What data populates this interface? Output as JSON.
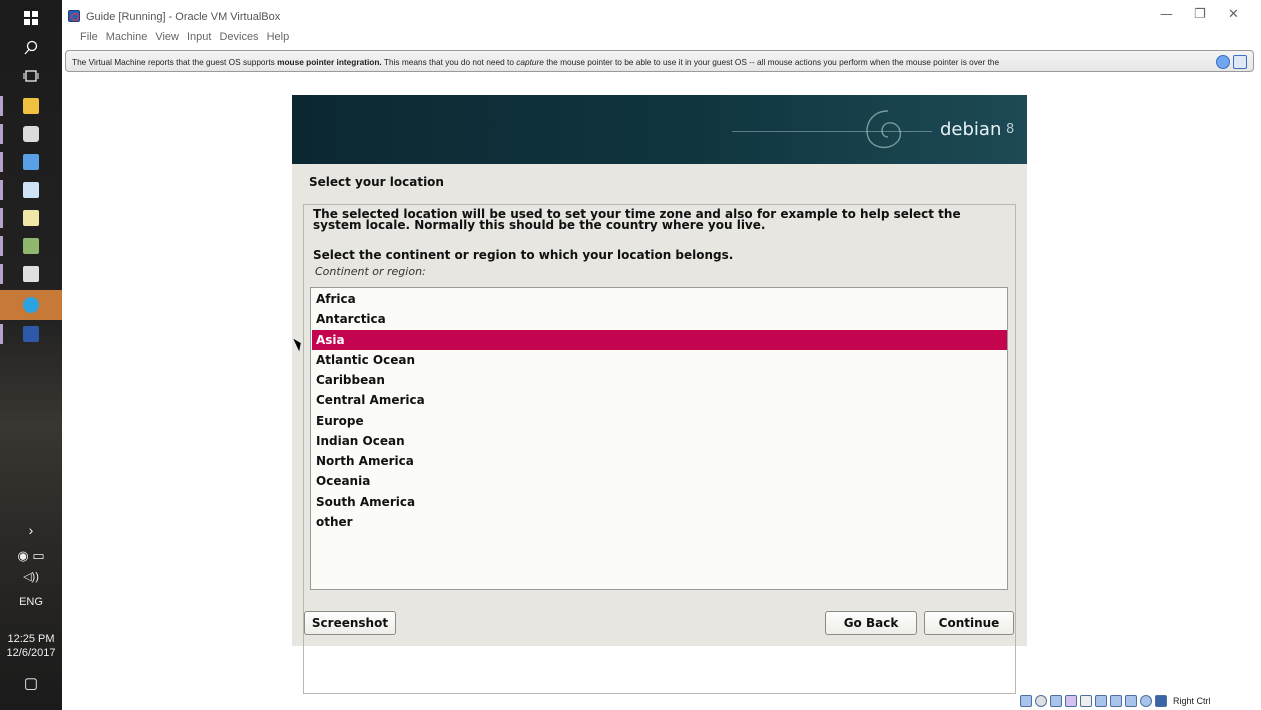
{
  "taskbar": {
    "language": "ENG",
    "time": "12:25 PM",
    "date": "12/6/2017"
  },
  "window": {
    "title": "Guide [Running] - Oracle VM VirtualBox",
    "menu": [
      "File",
      "Machine",
      "View",
      "Input",
      "Devices",
      "Help"
    ]
  },
  "notice": {
    "text_1": "The Virtual Machine reports that the guest OS supports ",
    "bold": "mouse pointer integration.",
    "text_2": " This means that you do not need to ",
    "italic": "capture",
    "text_3": " the mouse pointer to be able to use it in your guest OS -- all mouse actions you perform when the mouse pointer is over the"
  },
  "installer": {
    "brand": "debian",
    "version": "8",
    "step_title": "Select your location",
    "description": "The selected location will be used to set your time zone and also for example to help select the system locale. Normally this should be the country where you live.",
    "question": "Select the continent or region to which your location belongs.",
    "list_label": "Continent or region:",
    "options": [
      "Africa",
      "Antarctica",
      "Asia",
      "Atlantic Ocean",
      "Caribbean",
      "Central America",
      "Europe",
      "Indian Ocean",
      "North America",
      "Oceania",
      "South America",
      "other"
    ],
    "selected": "Asia",
    "buttons": {
      "screenshot": "Screenshot",
      "go_back": "Go Back",
      "continue": "Continue"
    }
  },
  "statusbar": {
    "host_key": "Right Ctrl"
  },
  "colors": {
    "selection": "#c50450",
    "banner": "#0b2832",
    "installer_bg": "#e7e6e1"
  }
}
